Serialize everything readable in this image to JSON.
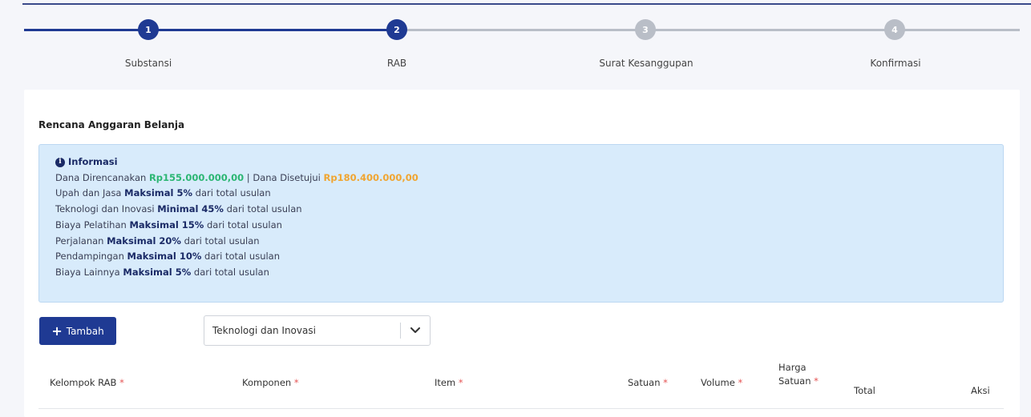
{
  "stepper": {
    "steps": [
      {
        "number": "1",
        "label": "Substansi",
        "state": "done"
      },
      {
        "number": "2",
        "label": "RAB",
        "state": "active"
      },
      {
        "number": "3",
        "label": "Surat Kesanggupan",
        "state": "todo"
      },
      {
        "number": "4",
        "label": "Konfirmasi",
        "state": "todo"
      }
    ],
    "colors": {
      "active": "#1f3a93",
      "inactive": "#b9bec7"
    }
  },
  "section": {
    "title": "Rencana Anggaran Belanja"
  },
  "info": {
    "heading": "Informasi",
    "line1": {
      "p1": "Dana Direncanakan ",
      "planned": "Rp155.000.000,00",
      "p2": " | Dana Disetujui ",
      "approved": "Rp180.400.000,00"
    },
    "rules": [
      {
        "pre": "Upah dan Jasa ",
        "bold": "Maksimal 5%",
        "post": " dari total usulan"
      },
      {
        "pre": "Teknologi dan Inovasi ",
        "bold": "Minimal 45%",
        "post": " dari total usulan"
      },
      {
        "pre": "Biaya Pelatihan ",
        "bold": "Maksimal 15%",
        "post": " dari total usulan"
      },
      {
        "pre": "Perjalanan ",
        "bold": "Maksimal 20%",
        "post": " dari total usulan"
      },
      {
        "pre": "Pendampingan ",
        "bold": "Maksimal 10%",
        "post": " dari total usulan"
      },
      {
        "pre": "Biaya Lainnya ",
        "bold": "Maksimal 5%",
        "post": " dari total usulan"
      }
    ],
    "colors": {
      "planned": "#2bb673",
      "approved": "#f0a531"
    }
  },
  "toolbar": {
    "add_label": "Tambah",
    "category_selected": "Teknologi dan Inovasi"
  },
  "table": {
    "headers": {
      "kelompok": "Kelompok RAB",
      "komponen": "Komponen",
      "item": "Item",
      "satuan": "Satuan",
      "volume": "Volume",
      "harga_line1": "Harga",
      "harga_line2": "Satuan",
      "total": "Total",
      "aksi": "Aksi"
    },
    "required_mark": "*"
  }
}
